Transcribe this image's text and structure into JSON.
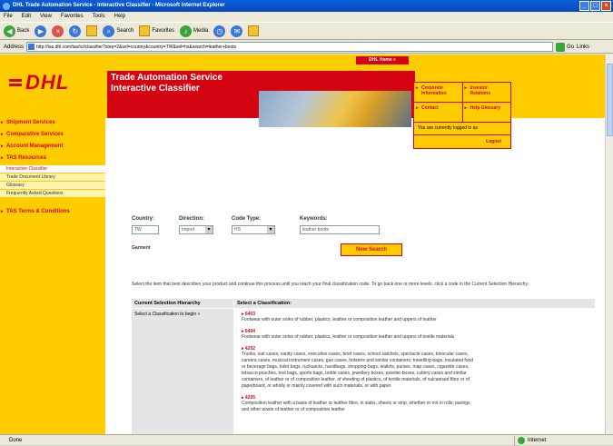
{
  "window": {
    "title": "DHL Trade Automation Service - Interactive Classifier - Microsoft Internet Explorer",
    "controls": [
      "_",
      "□",
      "×"
    ]
  },
  "menubar": [
    "File",
    "Edit",
    "View",
    "Favorites",
    "Tools",
    "Help"
  ],
  "toolbar": {
    "back": "Back",
    "search": "Search",
    "favorites": "Favorites",
    "media": "Media"
  },
  "addressbar": {
    "label": "Address",
    "url": "http://tas.dhl.com/tas/ic/iclassifier?step=2&sel=country&country=TW&sel=hs&search=leather+boots",
    "go": "Go",
    "links": "Links"
  },
  "header": {
    "logo": "DHL",
    "title_line1": "Trade Automation Service",
    "title_line2": "Interactive Classifier",
    "home_button": "DHL Home »"
  },
  "topnav": {
    "corporate": "Corporate Information",
    "investor": "Investor Relations",
    "contact": "Contact",
    "help": "Help Glossary",
    "logged_in": "You are currently logged in as",
    "logout": "Logout"
  },
  "leftnav": [
    {
      "label": "Shipment Services",
      "type": "section"
    },
    {
      "label": "Comparative Services",
      "type": "section"
    },
    {
      "label": "Account Management",
      "type": "section"
    },
    {
      "label": "TAS Resources",
      "type": "section"
    },
    {
      "label": "Interactive Classifier",
      "type": "sub",
      "active": true
    },
    {
      "label": "Trade Document Library",
      "type": "sub"
    },
    {
      "label": "Glossary",
      "type": "sub"
    },
    {
      "label": "Frequently Asked Questions",
      "type": "sub"
    },
    {
      "label": "TAS Terms & Conditions",
      "type": "section"
    }
  ],
  "form": {
    "country_label": "Country:",
    "country_value": "TW",
    "direction_label": "Direction:",
    "direction_value": "Import",
    "codetype_label": "Code Type:",
    "codetype_value": "HS",
    "keywords_label": "Keywords:",
    "keywords_value": "leather boots",
    "garment_label": "Garment",
    "new_search": "New Search"
  },
  "instructions": "Select the item that best describes your product and continue this process until you reach your final classification code. To go back one or more levels, click a code in the Current Selection Hierarchy.",
  "table": {
    "col1": "Current Selection Hierarchy",
    "col2": "Select a Classification:",
    "hierarchy_text": "Select a Classification to begin »",
    "options": [
      {
        "code": "6403",
        "desc": "Footwear with outer soles of rubber, plastics, leather or composition leather and uppers of leather"
      },
      {
        "code": "6404",
        "desc": "Footwear with outer soles of rubber, plastics, leather or composition leather and uppers of textile materials"
      },
      {
        "code": "4202",
        "desc": "Trunks, suit cases, vanity cases, executive cases, brief cases, school satchels, spectacle cases, binocular cases, camera cases, musical instrument cases, gun cases, holsters and similar containers; travelling-bags, insulated food or beverage bags, toilet bags, rucksacks, handbags, shopping-bags, wallets, purses, map cases, cigarette cases, tobacco pouches, tool bags, sports bags, bottle cases, jewellery boxes, powder-boxes, cutlery cases and similar containers, of leather or of composition leather, of sheeting of plastics, of textile materials, of vulcanised fibre or of paperboard, or wholly or mainly covered with such materials, or with paper"
      },
      {
        "code": "4205",
        "desc": "Composition leather with a basis of leather or leather fibre, in slabs, sheets or strip, whether or not in rolls; parings and other waste of leather or of composition leather"
      }
    ]
  },
  "status": {
    "left": "Done",
    "zone": "Internet"
  }
}
